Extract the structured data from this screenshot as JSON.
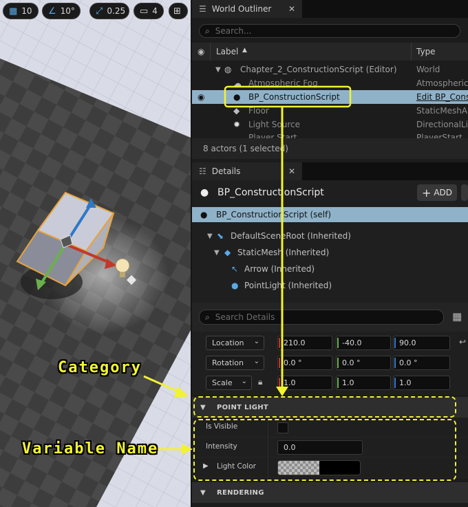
{
  "viewport": {
    "grid_snap": "10",
    "rotation_snap": "10°",
    "scale_snap": "0.25",
    "camera_speed": "4",
    "icons": [
      "grid-icon",
      "angle-icon",
      "scale-icon",
      "camera-icon",
      "layout-icon"
    ]
  },
  "outliner": {
    "tab_title": "World Outliner",
    "search_placeholder": "Search...",
    "col_label": "Label",
    "col_type": "Type",
    "rows": [
      {
        "label": "Chapter_2_ConstructionScript (Editor)",
        "type": "World"
      },
      {
        "label": "Atmospheric Fog",
        "type": "AtmosphericF"
      },
      {
        "label": "BP_ConstructionScript",
        "type": "Edit BP_Constr"
      },
      {
        "label": "Floor",
        "type": "StaticMeshA"
      },
      {
        "label": "Light Source",
        "type": "DirectionalLig"
      },
      {
        "label": "Player Start",
        "type": "PlayerStart"
      }
    ],
    "status": "8 actors (1 selected)"
  },
  "details": {
    "tab_title": "Details",
    "actor_name": "BP_ConstructionScript",
    "add_label": "ADD",
    "components": [
      "BP_ConstructionScript (self)",
      "DefaultSceneRoot (Inherited)",
      "StaticMesh (Inherited)",
      "Arrow (Inherited)",
      "PointLight (Inherited)"
    ],
    "search_placeholder": "Search Details",
    "transform": {
      "location_label": "Location",
      "rotation_label": "Rotation",
      "scale_label": "Scale",
      "location": [
        "210.0",
        "-40.0",
        "90.0"
      ],
      "rotation": [
        "0.0 °",
        "0.0 °",
        "0.0 °"
      ],
      "scale": [
        "1.0",
        "1.0",
        "1.0"
      ]
    },
    "category_point_light": "POINT LIGHT",
    "is_visible_label": "Is Visible",
    "intensity_label": "Intensity",
    "intensity_value": "0.0",
    "light_color_label": "Light Color",
    "category_rendering": "RENDERING"
  },
  "annotations": {
    "category": "Category",
    "variable_name": "Variable Name"
  },
  "colors": {
    "accent_yellow": "#f2f232",
    "selection": "#8fb2c9",
    "axis_x": "#c0392b",
    "axis_y": "#6ab04c",
    "axis_z": "#2f78c5"
  }
}
